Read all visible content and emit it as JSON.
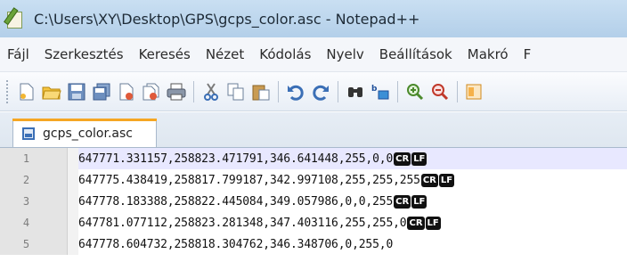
{
  "window": {
    "title": "C:\\Users\\XY\\Desktop\\GPS\\gcps_color.asc - Notepad++"
  },
  "menu": {
    "items": [
      "Fájl",
      "Szerkesztés",
      "Keresés",
      "Nézet",
      "Kódolás",
      "Nyelv",
      "Beállítások",
      "Makró",
      "F"
    ]
  },
  "toolbar": {
    "icons": [
      "new-file",
      "open-file",
      "save",
      "save-all",
      "close",
      "close-all",
      "print",
      "cut",
      "copy",
      "paste",
      "undo",
      "redo",
      "find",
      "replace",
      "zoom-in",
      "zoom-out",
      "sync"
    ]
  },
  "tabs": [
    {
      "label": "gcps_color.asc"
    }
  ],
  "editor": {
    "eol_cr": "CR",
    "eol_lf": "LF",
    "lines": [
      {
        "num": "1",
        "text": "647771.331157,258823.471791,346.641448,255,0,0",
        "eol": true
      },
      {
        "num": "2",
        "text": "647775.438419,258817.799187,342.997108,255,255,255",
        "eol": true
      },
      {
        "num": "3",
        "text": "647778.183388,258822.445084,349.057986,0,0,255",
        "eol": true
      },
      {
        "num": "4",
        "text": "647781.077112,258823.281348,347.403116,255,255,0",
        "eol": true
      },
      {
        "num": "5",
        "text": "647778.604732,258818.304762,346.348706,0,255,0",
        "eol": false
      }
    ]
  }
}
